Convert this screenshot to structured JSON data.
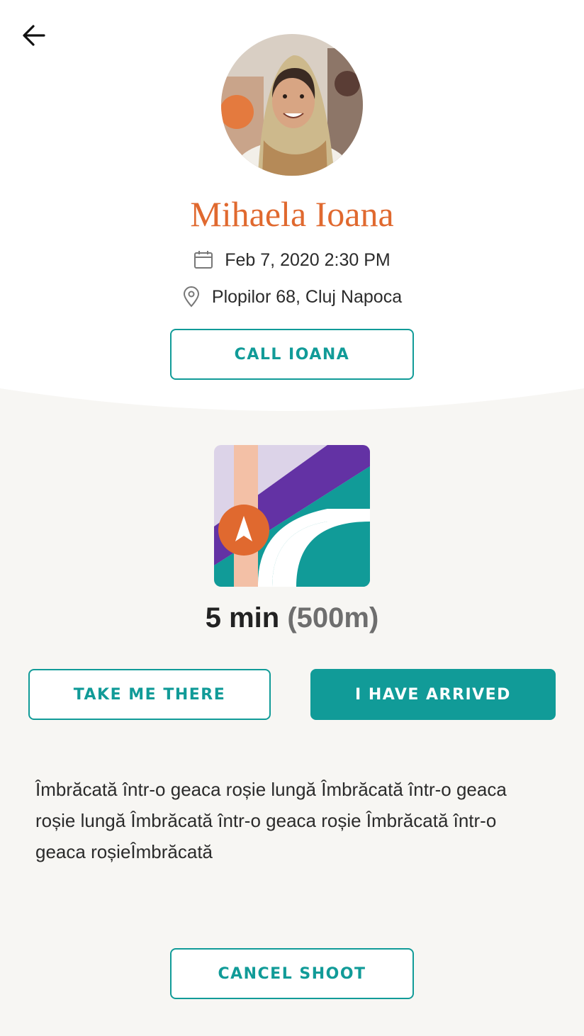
{
  "header": {
    "back_icon": "arrow-left-icon"
  },
  "profile": {
    "name": "Mihaela Ioana",
    "date_icon": "calendar-icon",
    "date": "Feb 7, 2020 2:30 PM",
    "location_icon": "location-pin-icon",
    "location": "Plopilor 68, Cluj Napoca",
    "call_label": "CALL IOANA"
  },
  "navigation": {
    "map_icon": "map-navigation-icon",
    "eta_time": "5 min",
    "eta_distance": "(500m)",
    "take_me_there_label": "TAKE ME THERE",
    "arrived_label": "I HAVE ARRIVED"
  },
  "description": "Îmbrăcată într-o geaca roșie lungă Îmbrăcată într-o geaca roșie lungă Îmbrăcată într-o geaca roșie Îmbrăcată într-o geaca roșieÎmbrăcată",
  "footer": {
    "cancel_label": "CANCEL SHOOT"
  },
  "colors": {
    "accent": "#119b98",
    "name": "#e0692f",
    "background": "#f7f6f3",
    "map_purple": "#6332a4",
    "map_lavender": "#dcd3e8",
    "map_peach": "#f3c0a6",
    "map_marker": "#e0692f"
  }
}
